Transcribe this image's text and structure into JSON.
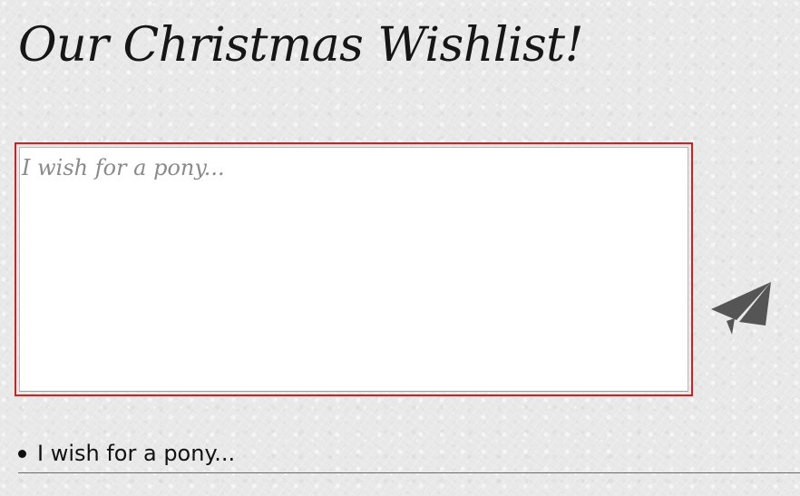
{
  "page": {
    "title": "Our Christmas Wishlist!"
  },
  "form": {
    "input_value": "",
    "input_placeholder": "I wish for a pony...",
    "send_icon": "paper-plane-icon",
    "colors": {
      "border_focus": "#d21f1f",
      "icon": "#555555"
    }
  },
  "wishlist": {
    "items": [
      {
        "text": "I wish for a pony..."
      }
    ]
  }
}
